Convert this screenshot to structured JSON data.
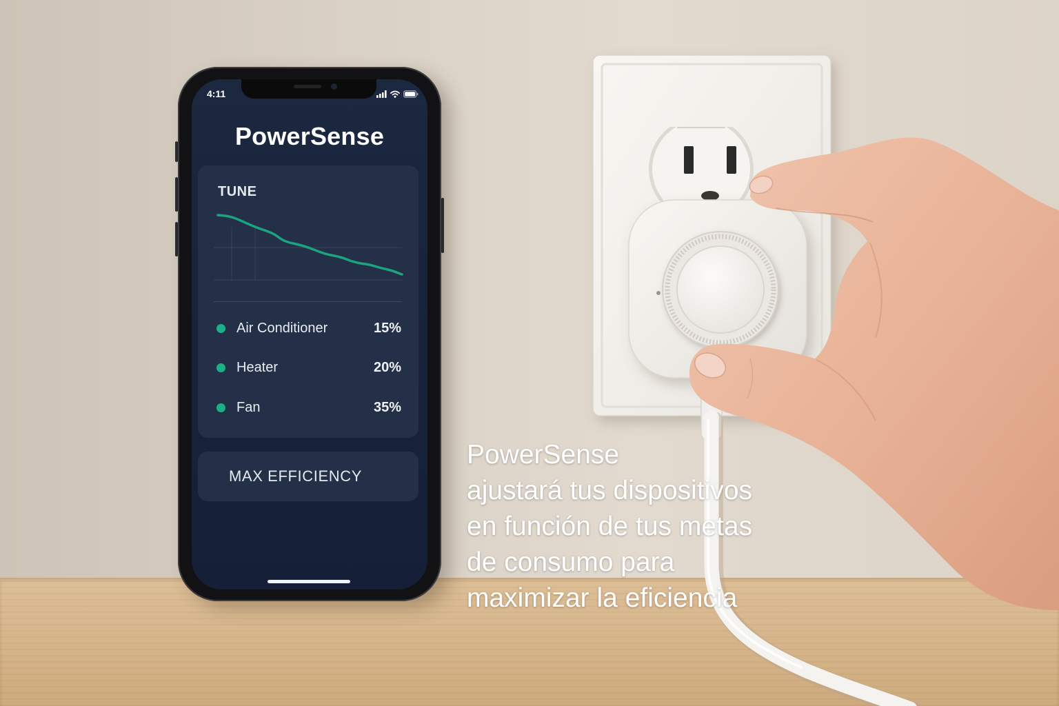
{
  "phone": {
    "status_bar": {
      "time": "4:11",
      "icons": {
        "signal": "signal-icon",
        "wifi": "wifi-icon",
        "battery": "battery-icon"
      }
    },
    "app": {
      "title": "PowerSense",
      "tune_card": {
        "label": "TUNE",
        "devices": [
          {
            "name": "Air Conditioner",
            "value": "15%"
          },
          {
            "name": "Heater",
            "value": "20%"
          },
          {
            "name": "Fan",
            "value": "35%"
          }
        ]
      },
      "action_button": {
        "label": "MAX EFFICIENCY"
      }
    }
  },
  "caption": {
    "lines": [
      "PowerSense",
      "ajustará tus dispositivos",
      "en función de tus metas",
      "de consumo para",
      "maximizar la eficiencia"
    ]
  },
  "colors": {
    "accent": "#1db088",
    "screen_background": "#18233a",
    "card_background": "#233047",
    "wall": "#ddd4c8",
    "desk": "#d5b489",
    "caption_text": "#ffffff"
  }
}
